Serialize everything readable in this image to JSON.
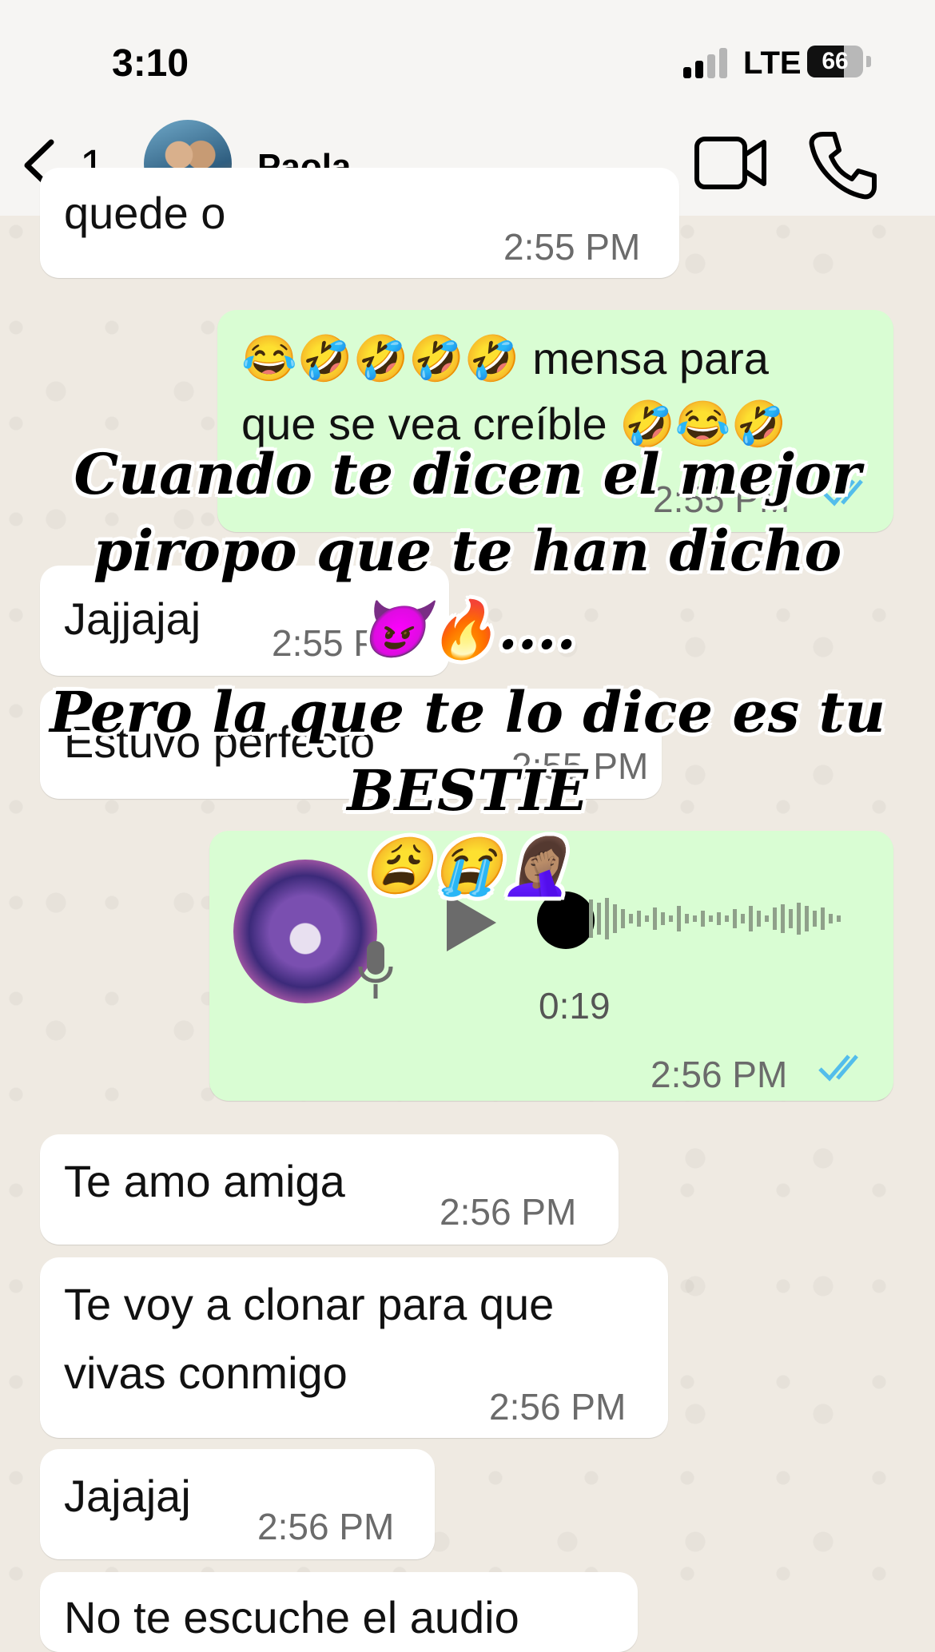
{
  "status_bar": {
    "time": "3:10",
    "network": "LTE",
    "battery": "66",
    "battery_level": 0.66
  },
  "header": {
    "back_count": "1",
    "contact_name": "Paola"
  },
  "messages": [
    {
      "partial_text": "quede o",
      "time": "2:55 PM"
    },
    {
      "text_line1": "😂🤣🤣🤣🤣 mensa para",
      "text_line2": "que se vea creíble 🤣😂🤣",
      "time": "2:55 PM"
    },
    {
      "text": "Jajjajaj",
      "time": "2:55 PM"
    },
    {
      "text": "Estuvo perfecto",
      "time": "2:55 PM"
    },
    {
      "duration": "0:19",
      "time": "2:56 PM"
    },
    {
      "text": "Te amo amiga",
      "time": "2:56 PM"
    },
    {
      "text_line1": "Te voy a clonar para que",
      "text_line2": "vivas conmigo",
      "time": "2:56 PM"
    },
    {
      "text": "Jajajaj",
      "time": "2:56 PM"
    },
    {
      "partial_text": "No te escuche el audio"
    }
  ],
  "caption": {
    "line1": "Cuando te dicen el mejor",
    "line2": "piropo que te han dicho",
    "line3": "😈🔥....",
    "line4": "Pero la que te lo dice es tu",
    "line5": "BESTIE",
    "line6": "😩😭🤦🏽‍♀️"
  },
  "colors": {
    "incoming": "#ffffff",
    "outgoing": "#d9fdd3",
    "background": "#efeae2",
    "read_ticks": "#53bdeb"
  }
}
